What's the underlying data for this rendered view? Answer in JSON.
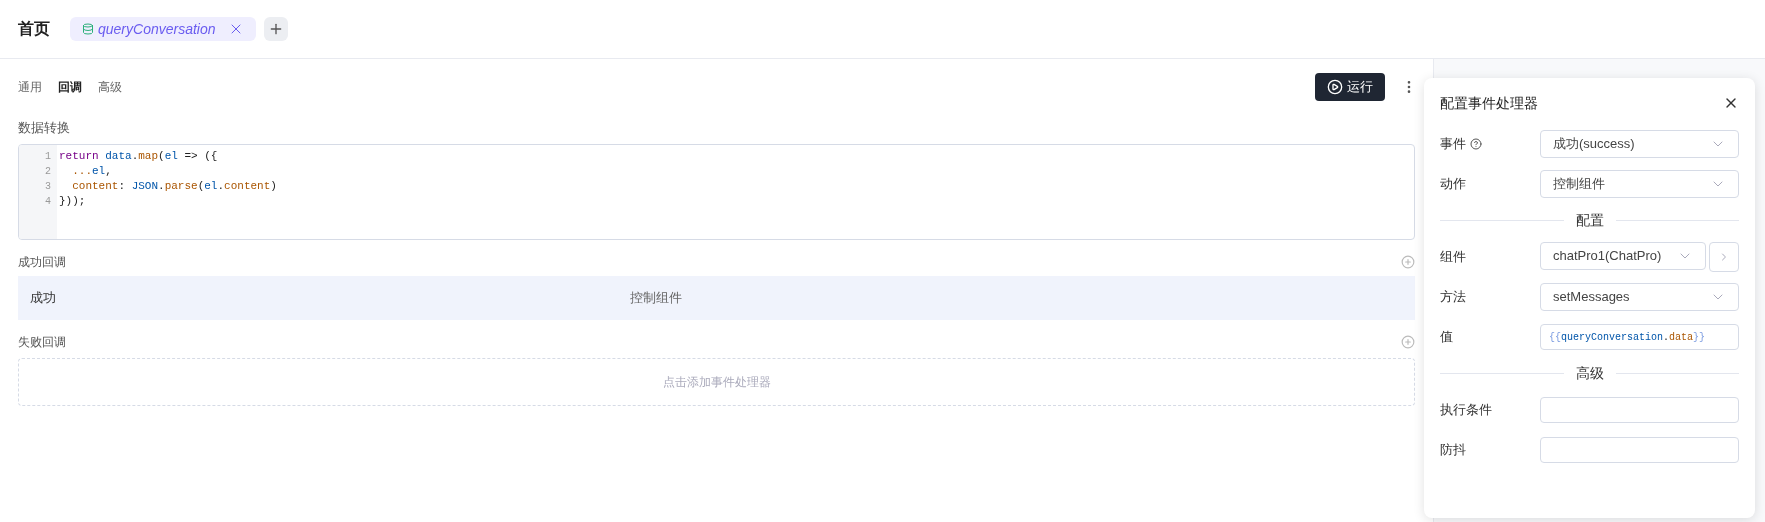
{
  "header": {
    "title": "首页",
    "query_tab": {
      "label": "queryConversation"
    }
  },
  "tabs": [
    {
      "label": "通用",
      "selected": false
    },
    {
      "label": "回调",
      "selected": true
    },
    {
      "label": "高级",
      "selected": false
    }
  ],
  "run_button": {
    "label": "运行"
  },
  "transform": {
    "label": "数据转换",
    "lines": [
      [
        {
          "text": "return",
          "kind": "keyword"
        },
        {
          "text": " data",
          "kind": "variable"
        },
        {
          "text": ".",
          "kind": "plain"
        },
        {
          "text": "map",
          "kind": "property"
        },
        {
          "text": "(",
          "kind": "plain"
        },
        {
          "text": "el",
          "kind": "variable"
        },
        {
          "text": " => ({",
          "kind": "plain"
        }
      ],
      [
        {
          "text": "  ...",
          "kind": "property"
        },
        {
          "text": "el",
          "kind": "variable"
        },
        {
          "text": ",",
          "kind": "plain"
        }
      ],
      [
        {
          "text": "  content",
          "kind": "property"
        },
        {
          "text": ": ",
          "kind": "plain"
        },
        {
          "text": "JSON",
          "kind": "variable"
        },
        {
          "text": ".",
          "kind": "plain"
        },
        {
          "text": "parse",
          "kind": "property"
        },
        {
          "text": "(",
          "kind": "plain"
        },
        {
          "text": "el",
          "kind": "variable"
        },
        {
          "text": ".",
          "kind": "plain"
        },
        {
          "text": "content",
          "kind": "property"
        },
        {
          "text": ")",
          "kind": "plain"
        }
      ],
      [
        {
          "text": "}));",
          "kind": "plain"
        }
      ]
    ],
    "line_numbers": [
      "1",
      "2",
      "3",
      "4"
    ]
  },
  "success": {
    "label": "成功回调",
    "handlers": [
      {
        "event": "成功",
        "action": "控制组件",
        "selected": true
      }
    ]
  },
  "failure": {
    "label": "失败回调",
    "placeholder": "点击添加事件处理器"
  },
  "panel": {
    "title": "配置事件处理器",
    "event": {
      "label": "事件",
      "value": "成功(success)"
    },
    "action": {
      "label": "动作",
      "value": "控制组件"
    },
    "config_heading": "配置",
    "component": {
      "label": "组件",
      "value": "chatPro1(ChatPro)"
    },
    "method": {
      "label": "方法",
      "value": "setMessages"
    },
    "value": {
      "label": "值",
      "tokens": [
        {
          "text": "{{",
          "kind": "brace"
        },
        {
          "text": "queryConversation",
          "kind": "variable"
        },
        {
          "text": ".",
          "kind": "plain"
        },
        {
          "text": "data",
          "kind": "property"
        },
        {
          "text": "}}",
          "kind": "brace"
        }
      ]
    },
    "advanced_heading": "高级",
    "condition": {
      "label": "执行条件"
    },
    "debounce": {
      "label": "防抖"
    }
  }
}
